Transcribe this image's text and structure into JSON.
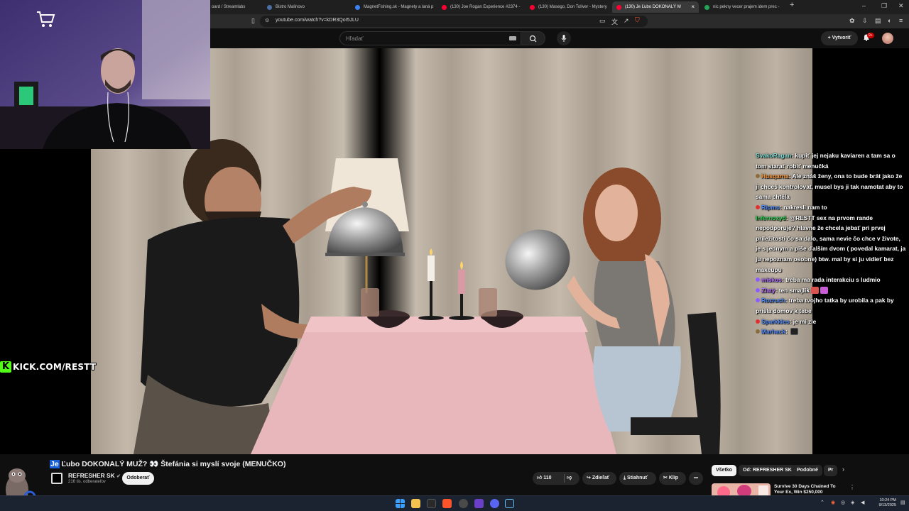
{
  "browser": {
    "tabs": [
      {
        "label": "oard / Streamlabs",
        "favicon": "#555555",
        "active": false
      },
      {
        "label": "Bistro Malinovo",
        "favicon": "#4a6fa5",
        "active": false
      },
      {
        "label": "MagnetFishing.sk - Magnety a laná p",
        "favicon": "#3b82f6",
        "active": false
      },
      {
        "label": "(130) Joe Rogan Experience #2374 -",
        "favicon": "#ff0033",
        "active": false
      },
      {
        "label": "(130) Masego, Don Toliver - Mystery",
        "favicon": "#ff0033",
        "active": false
      },
      {
        "label": "(130) Je Ľubo DOKONALÝ M",
        "favicon": "#ff0033",
        "active": true
      },
      {
        "label": "nic pekny vecer prajem idem prec -",
        "favicon": "#23a559",
        "active": false
      }
    ],
    "url": "youtube.com/watch?v=kDR3QoI5JLU"
  },
  "youtube": {
    "search_placeholder": "Hľadať",
    "create_label": "Vytvoriť",
    "notification_count": "9+",
    "video_title_highlight": "Je",
    "video_title_rest": " Ľubo DOKONALÝ MUŽ? 👀 Štefánia si myslí svoje (MENUČKO)",
    "channel_name": "REFRESHER SK",
    "channel_verified": "✔",
    "subscribers": "216 tis. odberateľov",
    "subscribe_label": "Odoberať",
    "like_count": "110",
    "share_label": "Zdieľať",
    "download_label": "Stiahnuť",
    "clip_label": "Klip",
    "more_label": "•••",
    "chips": [
      "Všetko",
      "Od: REFRESHER SK",
      "Podobné",
      "Pr"
    ],
    "recommended_title_1": "Survive 30 Days Chained To",
    "recommended_title_2": "Your Ex, Win $250,000"
  },
  "stream_overlay": {
    "kick_letter": "K",
    "kick_text": "KICK.COM/RESTT"
  },
  "chat": [
    {
      "user": "SvakoRagan",
      "color": "#7fe0d6",
      "badge": "",
      "text": "kupiť jej nejaku kaviaren a tam sa o tom starať robiť menučká"
    },
    {
      "user": "Husqarna",
      "color": "#ff9a3c",
      "badge": "#8a6d3b",
      "text": "Ale znáš ženy, ona to bude brát jako že ji chceš kontrolovat, musel bys ji tak namotat aby to sama chtěla"
    },
    {
      "user": "Ripmo",
      "color": "#4f8cff",
      "badge": "#e03131",
      "text": "nakresli nam to"
    },
    {
      "user": "Infernoxyd",
      "color": "#36d65a",
      "badge": "",
      "text": "@RESTT sex na prvom rande nepodporuje? hlavne že chcela jebať pri prvej príležitosti čo sa dalo, sama nevie čo chce v živote, je s jednym a piše ďalším dvom ( povedal kamarat, ja ju nepoznam osobne) btw. mal by si ju vidieť bez makeupu"
    },
    {
      "user": "miskos",
      "color": "#b070ff",
      "badge": "#8e5cff",
      "text": "treba ma rada interakciu s ludmio"
    },
    {
      "user": "Zlatý",
      "color": "#b070ff",
      "badge": "#8e5cff",
      "text": "ten smajlik",
      "emotes": [
        "#d9534f",
        "#c85bd6"
      ]
    },
    {
      "user": "Rozruch",
      "color": "#4f8cff",
      "badge": "#8e5cff",
      "text": "treba tvojho tatka by urobila a pak by prisla domov k tebe"
    },
    {
      "user": "Sparkkles",
      "color": "#4f8cff",
      "badge": "#e03131",
      "text": "je mi zle"
    },
    {
      "user": "Marhack",
      "color": "#4f8cff",
      "badge": "#8a6d3b",
      "text": "",
      "emotes": [
        "#222222"
      ]
    }
  ],
  "taskbar": {
    "time": "10:24 PM",
    "date": "9/13/2025"
  }
}
